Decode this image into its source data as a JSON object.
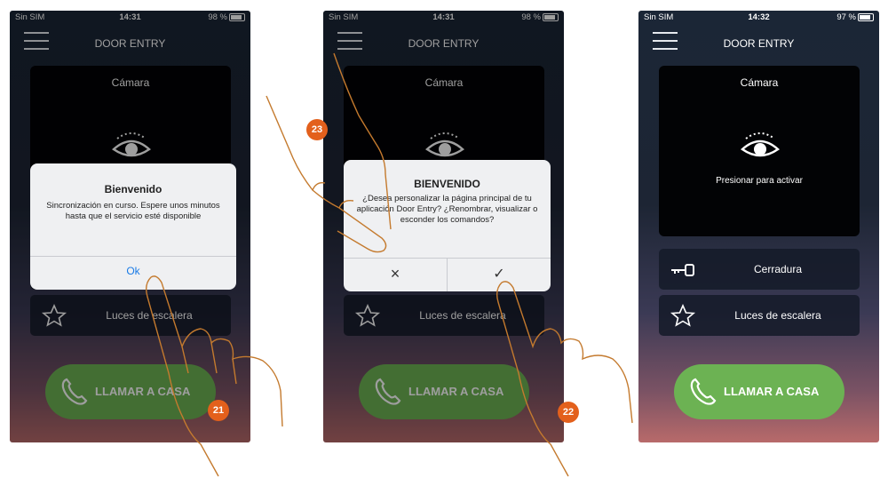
{
  "status_bar": [
    {
      "carrier": "Sin SIM",
      "time": "14:31",
      "battery": "98 %"
    },
    {
      "carrier": "Sin SIM",
      "time": "14:31",
      "battery": "98 %"
    },
    {
      "carrier": "Sin SIM",
      "time": "14:32",
      "battery": "97 %"
    }
  ],
  "app": {
    "title": "DOOR ENTRY",
    "camera_label": "Cámara",
    "camera_hint": "Presionar para activar",
    "lock_label": "Cerradura",
    "stairs_label": "Luces de escalera",
    "call_label": "LLAMAR A CASA"
  },
  "dialog_welcome": {
    "title": "Bienvenido",
    "message": "Sincronización en curso. Espere unos minutos hasta que el servicio esté disponible",
    "ok": "Ok"
  },
  "dialog_customize": {
    "title": "BIENVENIDO",
    "message": "¿Desea personalizar la página principal de tu aplicación Door Entry? ¿Renombrar, visualizar o esconder los comandos?",
    "cancel": "×",
    "confirm": "✓"
  },
  "callouts": [
    "21",
    "22",
    "23"
  ],
  "colors": {
    "accent_green": "#6cb253",
    "callout_orange": "#e3601c",
    "link_blue": "#1a7be6"
  }
}
